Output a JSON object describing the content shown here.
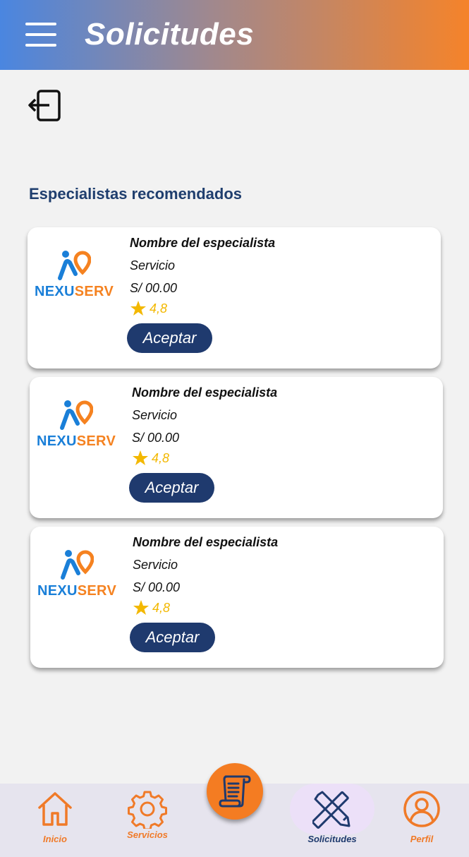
{
  "header": {
    "title": "Solicitudes",
    "menu_icon": "hamburger-menu-icon"
  },
  "logout_icon": "logout-icon",
  "section": {
    "title": "Especialistas recomendados"
  },
  "brand": {
    "nexu": "NEXU",
    "serv": "SERV",
    "blue": "#1a7fd8",
    "orange": "#f58220"
  },
  "specialists": [
    {
      "name": "Nombre del especialista",
      "service": "Servicio",
      "price": "S/ 00.00",
      "rating": "4,8",
      "button": "Aceptar"
    },
    {
      "name": "Nombre del especialista",
      "service": "Servicio",
      "price": "S/ 00.00",
      "rating": "4,8",
      "button": "Aceptar"
    },
    {
      "name": "Nombre del especialista",
      "service": "Servicio",
      "price": "S/ 00.00",
      "rating": "4,8",
      "button": "Aceptar"
    }
  ],
  "nav": {
    "items": [
      {
        "label": "Inicio",
        "icon": "home-icon"
      },
      {
        "label": "Servicios",
        "icon": "gear-icon"
      },
      {
        "label": "Solicitudes",
        "icon": "tools-icon",
        "active": true
      },
      {
        "label": "Perfil",
        "icon": "user-icon"
      }
    ],
    "fab_icon": "scroll-icon"
  },
  "colors": {
    "accent": "#f47c22",
    "primary": "#1f3a6e",
    "star": "#f3b800"
  }
}
